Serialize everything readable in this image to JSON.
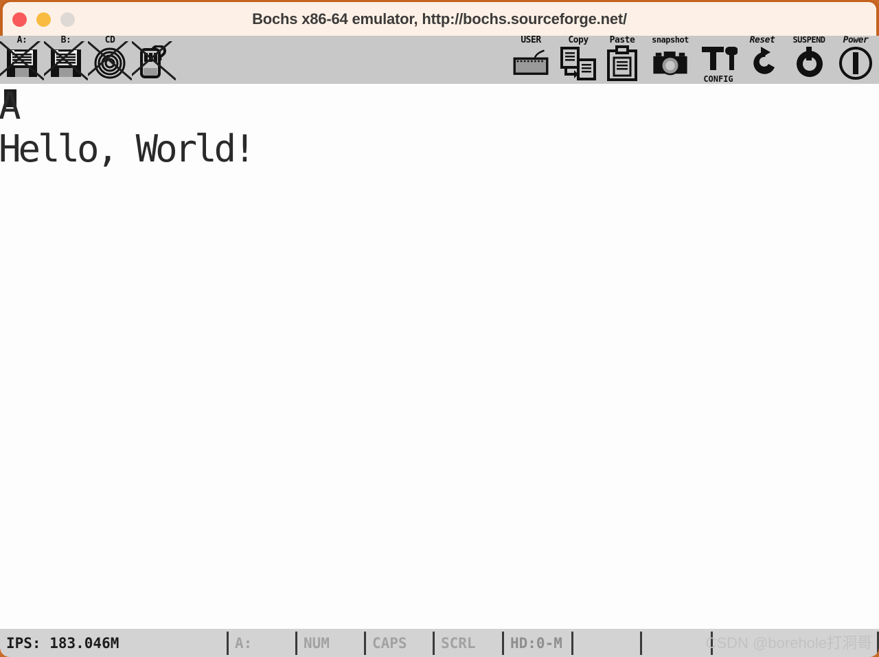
{
  "window": {
    "title": "Bochs x86-64 emulator, http://bochs.sourceforge.net/",
    "controls": [
      {
        "name": "close",
        "color": "#f9595b"
      },
      {
        "name": "minimize",
        "color": "#f9bb40"
      },
      {
        "name": "zoom",
        "color": "#ded9d4"
      }
    ],
    "frame_color": "#c4631f",
    "titlebar_color": "#fdf1e7"
  },
  "toolbar": {
    "background": "#c8c8c8",
    "left_items": [
      {
        "label": "A:",
        "icon": "floppy-drive-a-icon",
        "disabled": true
      },
      {
        "label": "B:",
        "icon": "floppy-drive-b-icon",
        "disabled": true
      },
      {
        "label": "CD",
        "icon": "cdrom-icon",
        "disabled": true
      },
      {
        "label": "",
        "icon": "mouse-icon",
        "disabled": true
      }
    ],
    "right_items": [
      {
        "label": "USER",
        "icon": "keyboard-icon",
        "sublabel": ""
      },
      {
        "label": "Copy",
        "icon": "copy-icon",
        "sublabel": ""
      },
      {
        "label": "Paste",
        "icon": "paste-icon",
        "sublabel": ""
      },
      {
        "label": "snapshot",
        "icon": "camera-icon",
        "sublabel": ""
      },
      {
        "label": "",
        "icon": "tools-icon",
        "sublabel": "CONFIG"
      },
      {
        "label": "Reset",
        "icon": "reset-arrow-icon",
        "sublabel": ""
      },
      {
        "label": "SUSPEND",
        "icon": "suspend-power-icon",
        "sublabel": ""
      },
      {
        "label": "Power",
        "icon": "power-circle-icon",
        "sublabel": ""
      }
    ]
  },
  "console": {
    "background": "#fdfdfd",
    "text_color": "#2a2a2a",
    "lines": [
      "A",
      "Hello, World!"
    ],
    "cursor_visible": true
  },
  "status_bar": {
    "background": "#d3d3d3",
    "ips": "IPS: 183.046M",
    "cells": [
      {
        "label": "A:",
        "state": "inactive"
      },
      {
        "label": "NUM",
        "state": "inactive"
      },
      {
        "label": "CAPS",
        "state": "inactive"
      },
      {
        "label": "SCRL",
        "state": "inactive"
      },
      {
        "label": "HD:0-M",
        "state": "active"
      },
      {
        "label": "",
        "state": "empty"
      },
      {
        "label": "",
        "state": "empty"
      }
    ],
    "watermark": "CSDN @borehole打洞哥"
  }
}
